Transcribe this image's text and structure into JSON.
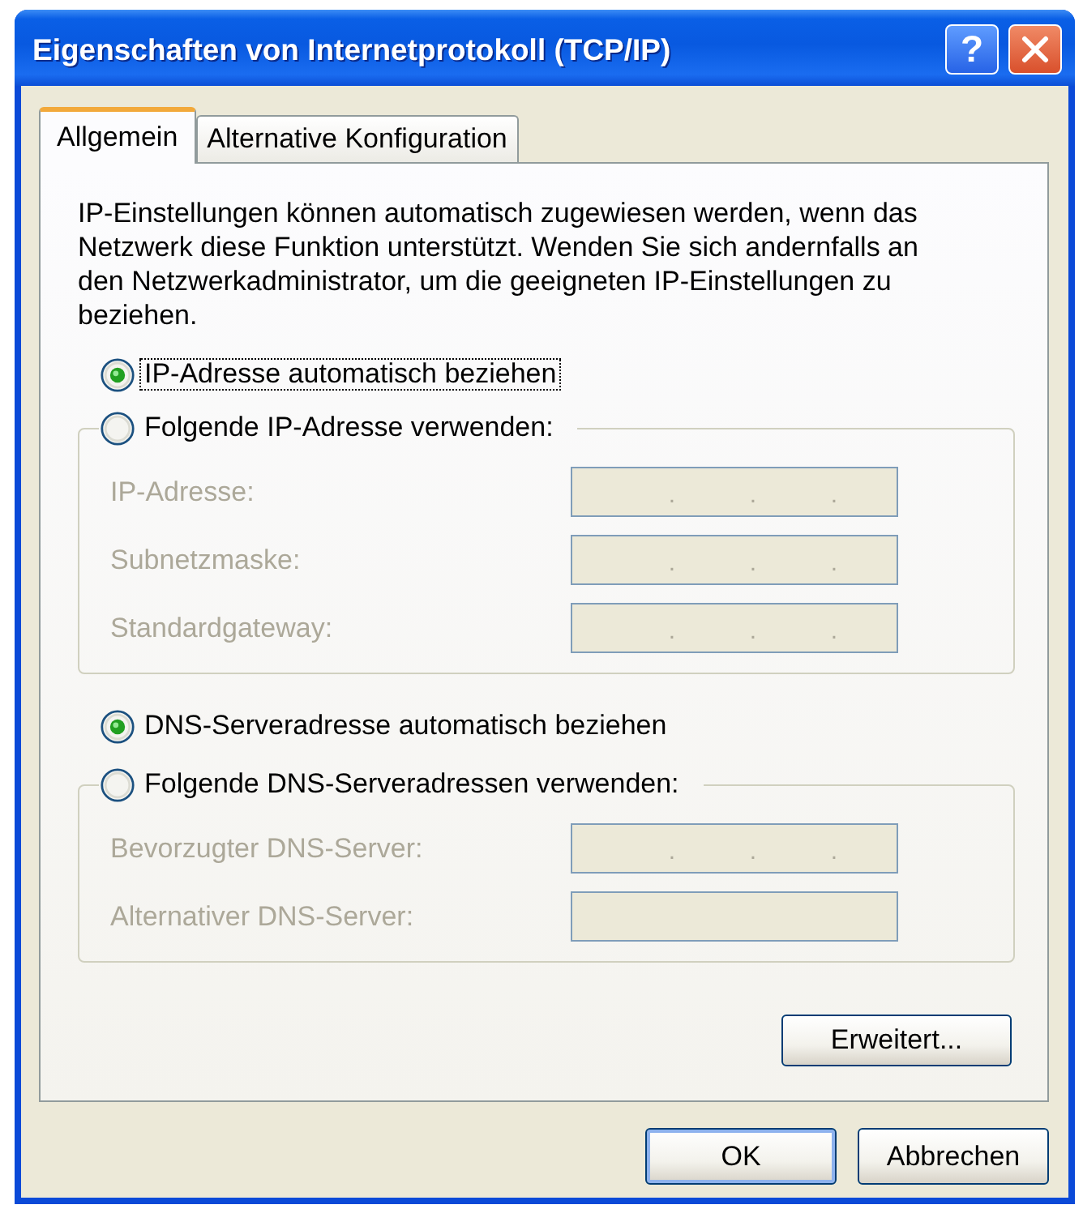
{
  "window": {
    "title": "Eigenschaften von Internetprotokoll (TCP/IP)",
    "buttons": [
      {
        "kind": "help",
        "label": "?"
      },
      {
        "kind": "close"
      }
    ]
  },
  "tabs": [
    {
      "label": "Allgemein",
      "selected": true
    },
    {
      "label": "Alternative Konfiguration",
      "selected": false
    }
  ],
  "description": "IP-Einstellungen können automatisch zugewiesen werden, wenn das Netzwerk diese Funktion unterstützt. Wenden Sie sich andernfalls an den Netzwerkadministrator, um die geeigneten IP-Einstellungen zu beziehen.",
  "sections": [
    {
      "options": [
        {
          "label": "IP-Adresse automatisch beziehen",
          "selected": true,
          "focused": true
        },
        {
          "label": "Folgende IP-Adresse verwenden:",
          "selected": false,
          "focused": false
        }
      ],
      "fields": [
        {
          "label": "IP-Adresse:",
          "kind": "ip",
          "disabled": true,
          "separators": [
            ".",
            ".",
            "."
          ]
        },
        {
          "label": "Subnetzmaske:",
          "kind": "ip",
          "disabled": true,
          "separators": [
            ".",
            ".",
            "."
          ]
        },
        {
          "label": "Standardgateway:",
          "kind": "ip",
          "disabled": true,
          "separators": [
            ".",
            ".",
            "."
          ]
        }
      ]
    },
    {
      "options": [
        {
          "label": "DNS-Serveradresse automatisch beziehen",
          "selected": true,
          "focused": false
        },
        {
          "label": "Folgende DNS-Serveradressen verwenden:",
          "selected": false,
          "focused": false
        }
      ],
      "fields": [
        {
          "label": "Bevorzugter DNS-Server:",
          "kind": "ip",
          "disabled": true,
          "separators": [
            ".",
            ".",
            "."
          ]
        },
        {
          "label": "Alternativer DNS-Server:",
          "kind": "ip",
          "disabled": true
        }
      ]
    }
  ],
  "advanced_button": {
    "label": "Erweitert..."
  },
  "dialog_buttons": [
    {
      "label": "OK",
      "default": true
    },
    {
      "label": "Abbrechen",
      "default": false
    }
  ]
}
